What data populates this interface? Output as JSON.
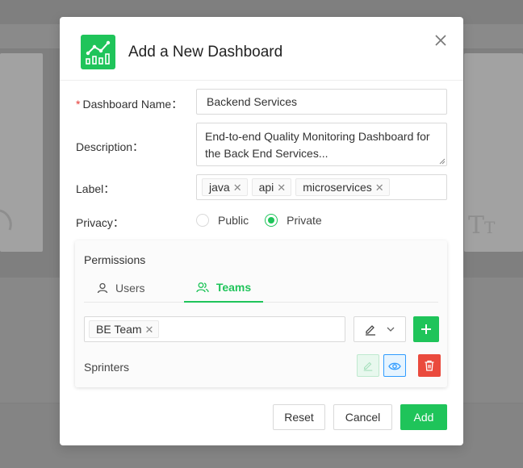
{
  "modal": {
    "title": "Add a New Dashboard",
    "icons": {
      "logo": "chart-icon",
      "close": "close-icon"
    }
  },
  "form": {
    "name_label": "Dashboard Name",
    "name_value": "Backend Services",
    "description_label": "Description",
    "description_value": "End-to-end Quality Monitoring Dashboard for the Back End Services...",
    "label_label": "Label",
    "labels": [
      "java",
      "api",
      "microservices"
    ],
    "privacy_label": "Privacy",
    "privacy_options": [
      "Public",
      "Private"
    ],
    "privacy_selected": "Private",
    "label_suffix": "："
  },
  "permissions": {
    "title": "Permissions",
    "tabs": [
      {
        "label": "Users",
        "icon": "user-icon",
        "active": false
      },
      {
        "label": "Teams",
        "icon": "team-icon",
        "active": true
      }
    ],
    "selected_teams": [
      "BE Team"
    ],
    "role_icon": "edit-icon",
    "rows": [
      {
        "name": "Sprinters",
        "edit_active": false,
        "view_active": true
      }
    ]
  },
  "footer": {
    "reset_label": "Reset",
    "cancel_label": "Cancel",
    "add_label": "Add"
  },
  "colors": {
    "primary": "#1fc45a",
    "danger": "#ea4a3d",
    "info": "#2f9bff",
    "required": "#e53935"
  }
}
